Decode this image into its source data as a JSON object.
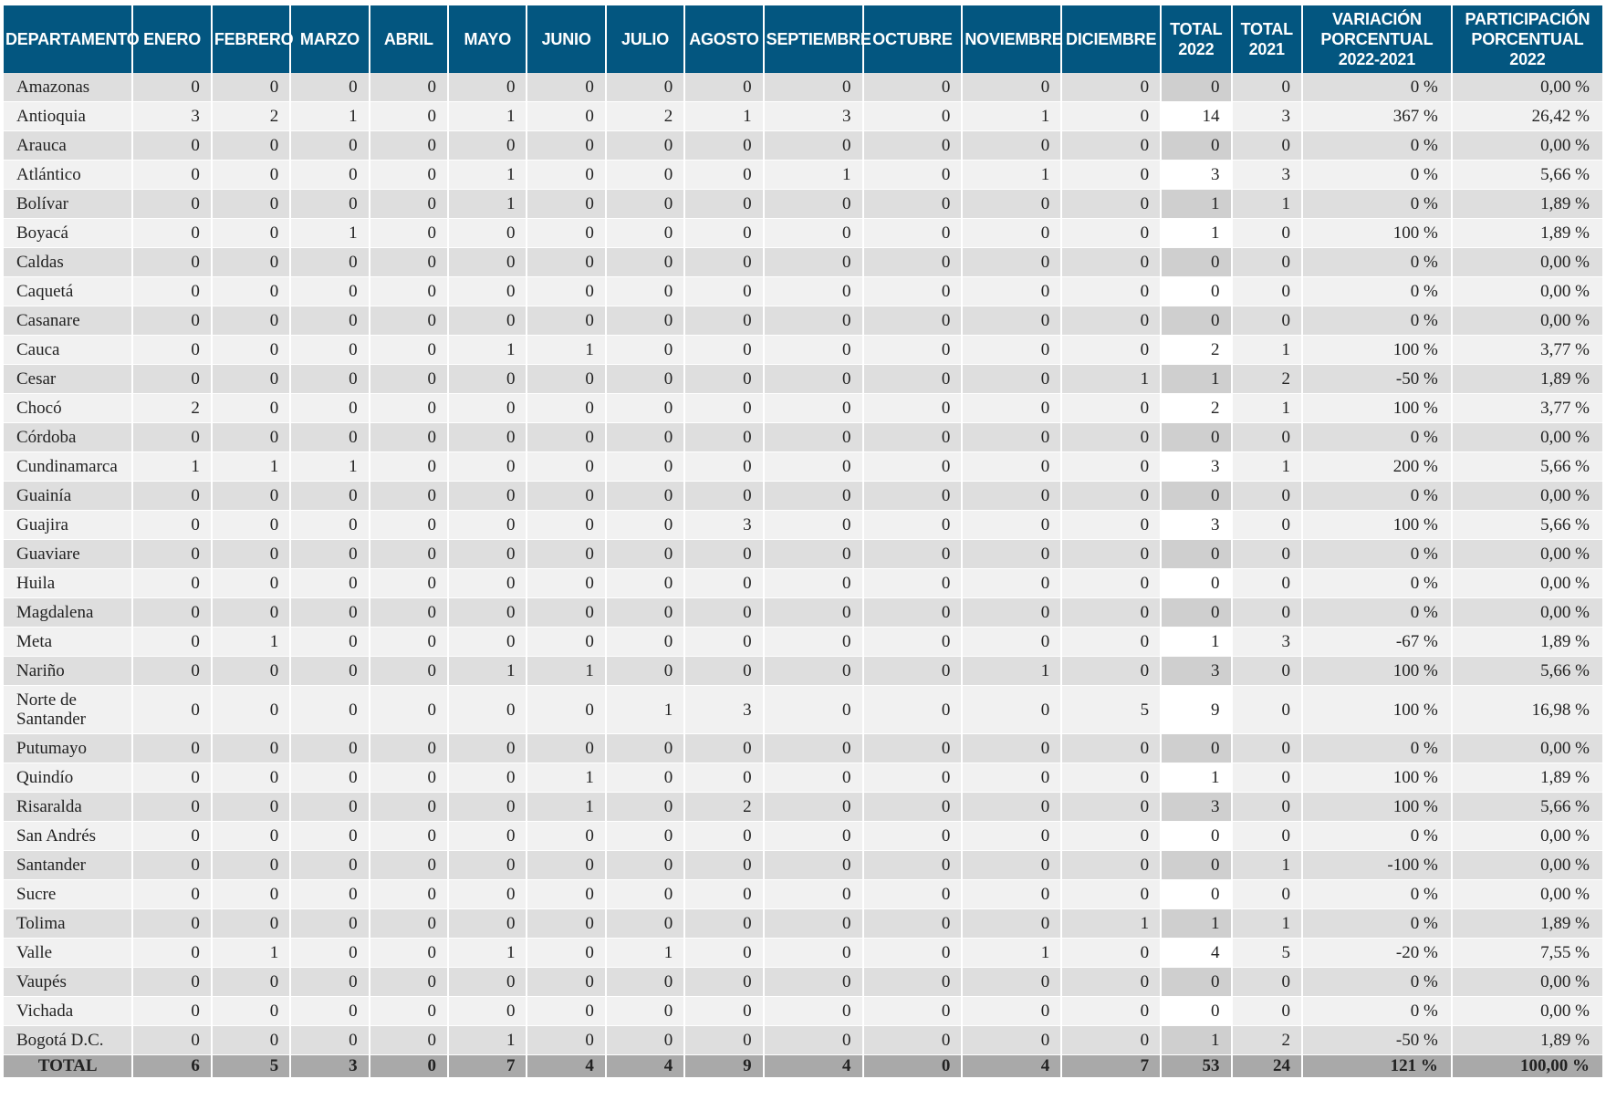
{
  "headers": [
    "DEPARTAMENTO",
    "ENERO",
    "FEBRERO",
    "MARZO",
    "ABRIL",
    "MAYO",
    "JUNIO",
    "JULIO",
    "AGOSTO",
    "SEPTIEMBRE",
    "OCTUBRE",
    "NOVIEMBRE",
    "DICIEMBRE",
    "TOTAL 2022",
    "TOTAL 2021",
    "VARIACIÓN PORCENTUAL 2022-2021",
    "PARTICIPACIÓN PORCENTUAL 2022"
  ],
  "rows": [
    {
      "dept": "Amazonas",
      "months": [
        "0",
        "0",
        "0",
        "0",
        "0",
        "0",
        "0",
        "0",
        "0",
        "0",
        "0",
        "0"
      ],
      "total_2022": "0",
      "total_2021": "0",
      "variation": "0 %",
      "participation": "0,00 %"
    },
    {
      "dept": "Antioquia",
      "months": [
        "3",
        "2",
        "1",
        "0",
        "1",
        "0",
        "2",
        "1",
        "3",
        "0",
        "1",
        "0"
      ],
      "total_2022": "14",
      "total_2021": "3",
      "variation": "367 %",
      "participation": "26,42 %"
    },
    {
      "dept": "Arauca",
      "months": [
        "0",
        "0",
        "0",
        "0",
        "0",
        "0",
        "0",
        "0",
        "0",
        "0",
        "0",
        "0"
      ],
      "total_2022": "0",
      "total_2021": "0",
      "variation": "0 %",
      "participation": "0,00 %"
    },
    {
      "dept": "Atlántico",
      "months": [
        "0",
        "0",
        "0",
        "0",
        "1",
        "0",
        "0",
        "0",
        "1",
        "0",
        "1",
        "0"
      ],
      "total_2022": "3",
      "total_2021": "3",
      "variation": "0 %",
      "participation": "5,66 %"
    },
    {
      "dept": "Bolívar",
      "months": [
        "0",
        "0",
        "0",
        "0",
        "1",
        "0",
        "0",
        "0",
        "0",
        "0",
        "0",
        "0"
      ],
      "total_2022": "1",
      "total_2021": "1",
      "variation": "0 %",
      "participation": "1,89 %"
    },
    {
      "dept": "Boyacá",
      "months": [
        "0",
        "0",
        "1",
        "0",
        "0",
        "0",
        "0",
        "0",
        "0",
        "0",
        "0",
        "0"
      ],
      "total_2022": "1",
      "total_2021": "0",
      "variation": "100 %",
      "participation": "1,89 %"
    },
    {
      "dept": "Caldas",
      "months": [
        "0",
        "0",
        "0",
        "0",
        "0",
        "0",
        "0",
        "0",
        "0",
        "0",
        "0",
        "0"
      ],
      "total_2022": "0",
      "total_2021": "0",
      "variation": "0 %",
      "participation": "0,00 %"
    },
    {
      "dept": "Caquetá",
      "months": [
        "0",
        "0",
        "0",
        "0",
        "0",
        "0",
        "0",
        "0",
        "0",
        "0",
        "0",
        "0"
      ],
      "total_2022": "0",
      "total_2021": "0",
      "variation": "0 %",
      "participation": "0,00 %"
    },
    {
      "dept": "Casanare",
      "months": [
        "0",
        "0",
        "0",
        "0",
        "0",
        "0",
        "0",
        "0",
        "0",
        "0",
        "0",
        "0"
      ],
      "total_2022": "0",
      "total_2021": "0",
      "variation": "0 %",
      "participation": "0,00 %"
    },
    {
      "dept": "Cauca",
      "months": [
        "0",
        "0",
        "0",
        "0",
        "1",
        "1",
        "0",
        "0",
        "0",
        "0",
        "0",
        "0"
      ],
      "total_2022": "2",
      "total_2021": "1",
      "variation": "100 %",
      "participation": "3,77 %"
    },
    {
      "dept": "Cesar",
      "months": [
        "0",
        "0",
        "0",
        "0",
        "0",
        "0",
        "0",
        "0",
        "0",
        "0",
        "0",
        "1"
      ],
      "total_2022": "1",
      "total_2021": "2",
      "variation": "-50 %",
      "participation": "1,89 %"
    },
    {
      "dept": "Chocó",
      "months": [
        "2",
        "0",
        "0",
        "0",
        "0",
        "0",
        "0",
        "0",
        "0",
        "0",
        "0",
        "0"
      ],
      "total_2022": "2",
      "total_2021": "1",
      "variation": "100 %",
      "participation": "3,77 %"
    },
    {
      "dept": "Córdoba",
      "months": [
        "0",
        "0",
        "0",
        "0",
        "0",
        "0",
        "0",
        "0",
        "0",
        "0",
        "0",
        "0"
      ],
      "total_2022": "0",
      "total_2021": "0",
      "variation": "0 %",
      "participation": "0,00 %"
    },
    {
      "dept": "Cundinamarca",
      "months": [
        "1",
        "1",
        "1",
        "0",
        "0",
        "0",
        "0",
        "0",
        "0",
        "0",
        "0",
        "0"
      ],
      "total_2022": "3",
      "total_2021": "1",
      "variation": "200 %",
      "participation": "5,66 %"
    },
    {
      "dept": "Guainía",
      "months": [
        "0",
        "0",
        "0",
        "0",
        "0",
        "0",
        "0",
        "0",
        "0",
        "0",
        "0",
        "0"
      ],
      "total_2022": "0",
      "total_2021": "0",
      "variation": "0 %",
      "participation": "0,00 %"
    },
    {
      "dept": "Guajira",
      "months": [
        "0",
        "0",
        "0",
        "0",
        "0",
        "0",
        "0",
        "3",
        "0",
        "0",
        "0",
        "0"
      ],
      "total_2022": "3",
      "total_2021": "0",
      "variation": "100 %",
      "participation": "5,66 %"
    },
    {
      "dept": "Guaviare",
      "months": [
        "0",
        "0",
        "0",
        "0",
        "0",
        "0",
        "0",
        "0",
        "0",
        "0",
        "0",
        "0"
      ],
      "total_2022": "0",
      "total_2021": "0",
      "variation": "0 %",
      "participation": "0,00 %"
    },
    {
      "dept": "Huila",
      "months": [
        "0",
        "0",
        "0",
        "0",
        "0",
        "0",
        "0",
        "0",
        "0",
        "0",
        "0",
        "0"
      ],
      "total_2022": "0",
      "total_2021": "0",
      "variation": "0 %",
      "participation": "0,00 %"
    },
    {
      "dept": "Magdalena",
      "months": [
        "0",
        "0",
        "0",
        "0",
        "0",
        "0",
        "0",
        "0",
        "0",
        "0",
        "0",
        "0"
      ],
      "total_2022": "0",
      "total_2021": "0",
      "variation": "0 %",
      "participation": "0,00 %"
    },
    {
      "dept": "Meta",
      "months": [
        "0",
        "1",
        "0",
        "0",
        "0",
        "0",
        "0",
        "0",
        "0",
        "0",
        "0",
        "0"
      ],
      "total_2022": "1",
      "total_2021": "3",
      "variation": "-67 %",
      "participation": "1,89 %"
    },
    {
      "dept": "Nariño",
      "months": [
        "0",
        "0",
        "0",
        "0",
        "1",
        "1",
        "0",
        "0",
        "0",
        "0",
        "1",
        "0"
      ],
      "total_2022": "3",
      "total_2021": "0",
      "variation": "100 %",
      "participation": "5,66 %"
    },
    {
      "dept": "Norte de Santander",
      "months": [
        "0",
        "0",
        "0",
        "0",
        "0",
        "0",
        "1",
        "3",
        "0",
        "0",
        "0",
        "5"
      ],
      "total_2022": "9",
      "total_2021": "0",
      "variation": "100 %",
      "participation": "16,98 %"
    },
    {
      "dept": "Putumayo",
      "months": [
        "0",
        "0",
        "0",
        "0",
        "0",
        "0",
        "0",
        "0",
        "0",
        "0",
        "0",
        "0"
      ],
      "total_2022": "0",
      "total_2021": "0",
      "variation": "0 %",
      "participation": "0,00 %"
    },
    {
      "dept": "Quindío",
      "months": [
        "0",
        "0",
        "0",
        "0",
        "0",
        "1",
        "0",
        "0",
        "0",
        "0",
        "0",
        "0"
      ],
      "total_2022": "1",
      "total_2021": "0",
      "variation": "100 %",
      "participation": "1,89 %"
    },
    {
      "dept": "Risaralda",
      "months": [
        "0",
        "0",
        "0",
        "0",
        "0",
        "1",
        "0",
        "2",
        "0",
        "0",
        "0",
        "0"
      ],
      "total_2022": "3",
      "total_2021": "0",
      "variation": "100 %",
      "participation": "5,66 %"
    },
    {
      "dept": "San Andrés",
      "months": [
        "0",
        "0",
        "0",
        "0",
        "0",
        "0",
        "0",
        "0",
        "0",
        "0",
        "0",
        "0"
      ],
      "total_2022": "0",
      "total_2021": "0",
      "variation": "0 %",
      "participation": "0,00 %"
    },
    {
      "dept": "Santander",
      "months": [
        "0",
        "0",
        "0",
        "0",
        "0",
        "0",
        "0",
        "0",
        "0",
        "0",
        "0",
        "0"
      ],
      "total_2022": "0",
      "total_2021": "1",
      "variation": "-100 %",
      "participation": "0,00 %"
    },
    {
      "dept": "Sucre",
      "months": [
        "0",
        "0",
        "0",
        "0",
        "0",
        "0",
        "0",
        "0",
        "0",
        "0",
        "0",
        "0"
      ],
      "total_2022": "0",
      "total_2021": "0",
      "variation": "0 %",
      "participation": "0,00 %"
    },
    {
      "dept": "Tolima",
      "months": [
        "0",
        "0",
        "0",
        "0",
        "0",
        "0",
        "0",
        "0",
        "0",
        "0",
        "0",
        "1"
      ],
      "total_2022": "1",
      "total_2021": "1",
      "variation": "0 %",
      "participation": "1,89 %"
    },
    {
      "dept": "Valle",
      "months": [
        "0",
        "1",
        "0",
        "0",
        "1",
        "0",
        "1",
        "0",
        "0",
        "0",
        "1",
        "0"
      ],
      "total_2022": "4",
      "total_2021": "5",
      "variation": "-20 %",
      "participation": "7,55 %"
    },
    {
      "dept": "Vaupés",
      "months": [
        "0",
        "0",
        "0",
        "0",
        "0",
        "0",
        "0",
        "0",
        "0",
        "0",
        "0",
        "0"
      ],
      "total_2022": "0",
      "total_2021": "0",
      "variation": "0 %",
      "participation": "0,00 %"
    },
    {
      "dept": "Vichada",
      "months": [
        "0",
        "0",
        "0",
        "0",
        "0",
        "0",
        "0",
        "0",
        "0",
        "0",
        "0",
        "0"
      ],
      "total_2022": "0",
      "total_2021": "0",
      "variation": "0 %",
      "participation": "0,00 %"
    },
    {
      "dept": "Bogotá D.C.",
      "months": [
        "0",
        "0",
        "0",
        "0",
        "1",
        "0",
        "0",
        "0",
        "0",
        "0",
        "0",
        "0"
      ],
      "total_2022": "1",
      "total_2021": "2",
      "variation": "-50 %",
      "participation": "1,89 %"
    }
  ],
  "total_row": {
    "dept": "TOTAL",
    "months": [
      "6",
      "5",
      "3",
      "0",
      "7",
      "4",
      "4",
      "9",
      "4",
      "0",
      "4",
      "7"
    ],
    "total_2022": "53",
    "total_2021": "24",
    "variation": "121 %",
    "participation": "100,00 %"
  },
  "colors": {
    "header_bg": "#035680",
    "header_text": "#ffffff",
    "row_light": "#f1f1f1",
    "row_dark": "#dedede",
    "total_bg": "#a9a9a9"
  }
}
